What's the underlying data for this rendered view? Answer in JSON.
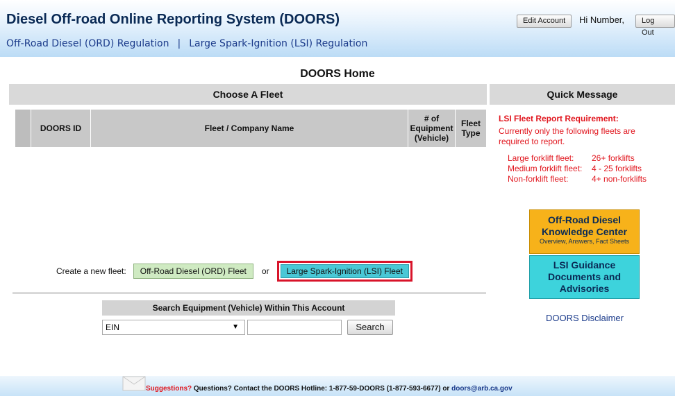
{
  "header": {
    "title": "Diesel Off-road Online Reporting System (DOORS)",
    "nav": {
      "ord_link": "Off-Road Diesel (ORD) Regulation",
      "separator": "|",
      "lsi_link": "Large Spark-Ignition (LSI) Regulation"
    },
    "edit_account": "Edit Account",
    "greeting": "Hi Number,",
    "log_out": "Log Out"
  },
  "page_title": "DOORS Home",
  "choose_fleet": {
    "heading": "Choose A Fleet",
    "columns": {
      "doors_id": "DOORS ID",
      "fleet_name": "Fleet / Company Name",
      "equipment_count": "# of Equipment (Vehicle)",
      "fleet_type": "Fleet Type"
    },
    "rows": []
  },
  "create": {
    "label": "Create a new fleet:",
    "ord_button": "Off-Road Diesel (ORD) Fleet",
    "or_text": "or",
    "lsi_button": "Large Spark-Ignition (LSI) Fleet"
  },
  "search": {
    "heading": "Search Equipment (Vehicle) Within This Account",
    "selected_field": "EIN",
    "query_value": "",
    "button": "Search"
  },
  "quick_message": {
    "heading": "Quick Message",
    "title": "LSI Fleet Report Requirement:",
    "body": "Currently only the following fleets are required to report.",
    "fleets": [
      {
        "name": "Large forklift fleet:",
        "threshold": "26+ forklifts"
      },
      {
        "name": "Medium forklift fleet:",
        "threshold": "4 - 25 forklifts"
      },
      {
        "name": "Non-forklift fleet:",
        "threshold": "4+ non-forklifts"
      }
    ]
  },
  "knowledge_center": {
    "title_line1": "Off-Road Diesel",
    "title_line2": "Knowledge Center",
    "subtitle": "Overview, Answers, Fact Sheets"
  },
  "lsi_guidance": {
    "line1": "LSI Guidance",
    "line2": "Documents and",
    "line3": "Advisories"
  },
  "disclaimer": "DOORS Disclaimer",
  "footer": {
    "suggestions": "Suggestions?",
    "questions": " Questions? Contact the DOORS Hotline: 1-877-59-DOORS (1-877-593-6677) or ",
    "email": "doors@arb.ca.gov"
  },
  "colors": {
    "title_blue": "#0a2a55",
    "link_blue": "#1a3a8a",
    "alert_red": "#e1161e",
    "ord_green": "#cfeac2",
    "lsi_cyan": "#49c8d6",
    "kc_orange": "#f7b21a",
    "highlight_red": "#d8142a"
  }
}
